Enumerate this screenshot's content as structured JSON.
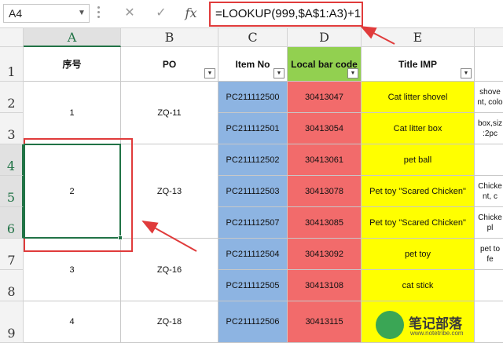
{
  "name_box": "A4",
  "formula_bar": {
    "cancel_icon": "✕",
    "enter_icon": "✓",
    "fx_label": "fx",
    "formula": "=LOOKUP(999,$A$1:A3)+1"
  },
  "columns": [
    "A",
    "B",
    "C",
    "D",
    "E"
  ],
  "rows": [
    "1",
    "2",
    "3",
    "4",
    "5",
    "6",
    "7",
    "8",
    "9"
  ],
  "headers": {
    "a": "序号",
    "b": "PO",
    "c": "Item No",
    "d": "Local bar code",
    "e": "Title IMP"
  },
  "groups": [
    {
      "seq": "1",
      "po": "ZQ-11"
    },
    {
      "seq": "2",
      "po": "ZQ-13"
    },
    {
      "seq": "3",
      "po": "ZQ-16"
    },
    {
      "seq": "4",
      "po": "ZQ-18"
    }
  ],
  "items": [
    {
      "item": "PC211112500",
      "code": "30413047",
      "title": "Cat litter shovel",
      "f": "shove\nnt, colo"
    },
    {
      "item": "PC211112501",
      "code": "30413054",
      "title": "Cat litter box",
      "f": "box,siz\n:2pc"
    },
    {
      "item": "PC211112502",
      "code": "30413061",
      "title": "pet ball",
      "f": ""
    },
    {
      "item": "PC211112503",
      "code": "30413078",
      "title": "Pet toy \"Scared Chicken\"",
      "f": "Chicke\nnt, c"
    },
    {
      "item": "PC211112507",
      "code": "30413085",
      "title": "Pet toy \"Scared Chicken\"",
      "f": "Chicke\npl"
    },
    {
      "item": "PC211112504",
      "code": "30413092",
      "title": "pet toy",
      "f": "pet to\nfe"
    },
    {
      "item": "PC211112505",
      "code": "30413108",
      "title": "cat stick",
      "f": ""
    },
    {
      "item": "PC211112506",
      "code": "30413115",
      "title": "",
      "f": ""
    }
  ],
  "watermark": {
    "text": "笔记部落",
    "url": "www.notetribe.com"
  },
  "colors": {
    "item_no": "#8db4e2",
    "bar_code": "#f26b6b",
    "title": "#ffff00",
    "header_green": "#92d050",
    "annotation": "#e03b3b",
    "selection": "#217346"
  }
}
